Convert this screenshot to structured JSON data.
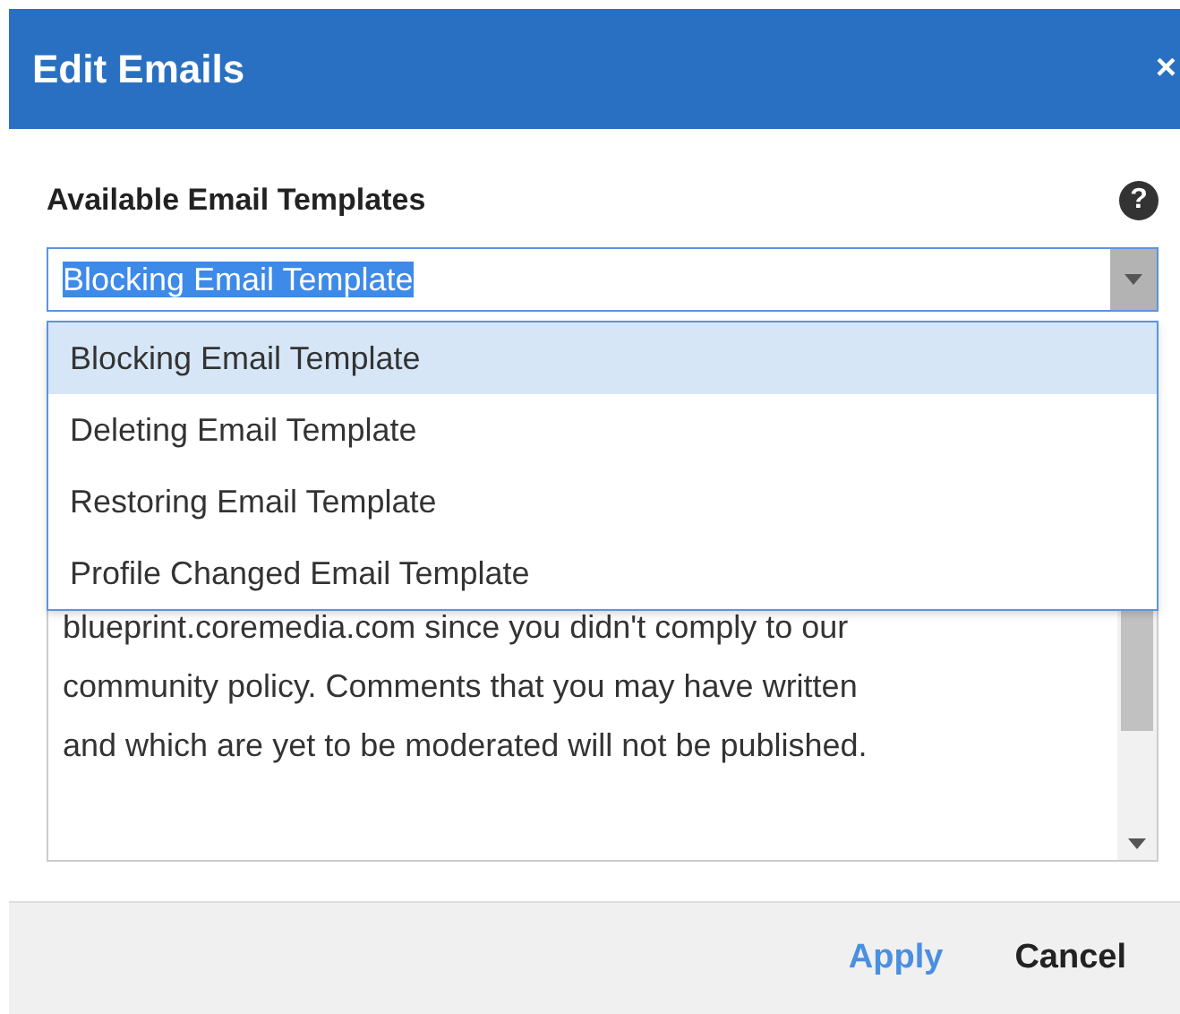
{
  "dialog": {
    "title": "Edit Emails",
    "close": "×"
  },
  "field": {
    "label": "Available Email Templates",
    "help": "?",
    "value": "Blocking Email Template",
    "value_selected": true
  },
  "dropdown": {
    "expanded": true,
    "options": [
      {
        "label": "Blocking Email Template",
        "selected": true
      },
      {
        "label": "Deleting Email Template",
        "selected": false
      },
      {
        "label": "Restoring Email Template",
        "selected": false
      },
      {
        "label": "Profile Changed Email Template",
        "selected": false
      }
    ]
  },
  "message": {
    "text": "blueprint.coremedia.com since you didn't comply to our\ncommunity policy. Comments that you may have written\nand which are yet to be moderated will not be published."
  },
  "buttons": [
    {
      "label": "Apply",
      "kind": "primary"
    },
    {
      "label": "Cancel",
      "kind": "secondary"
    }
  ]
}
